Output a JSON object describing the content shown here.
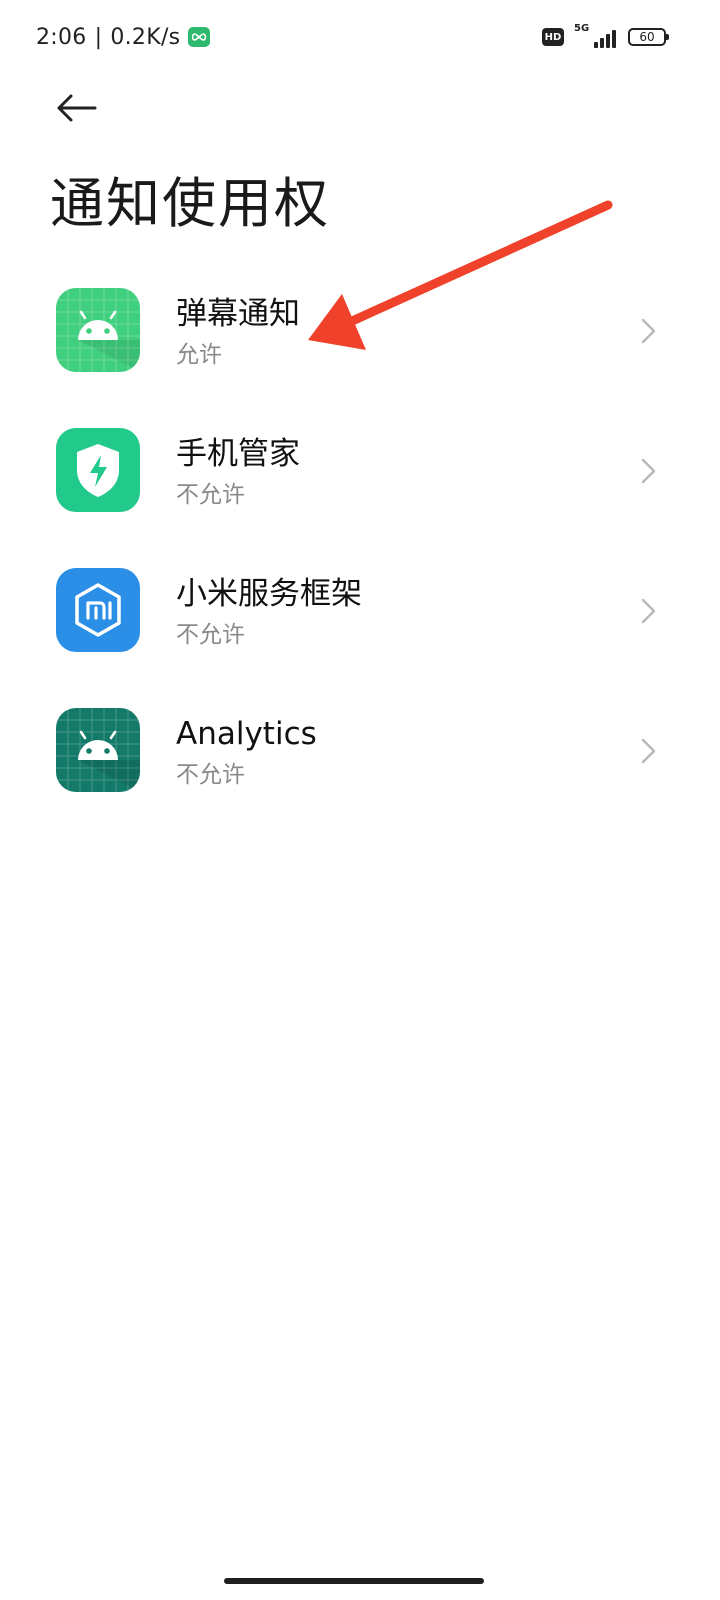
{
  "status_bar": {
    "time": "2:06",
    "separator": "|",
    "net_speed": "0.2K/s",
    "hd_label": "HD",
    "network_type": "5G",
    "battery": "60",
    "vpn_icon": "infinity-app-icon",
    "accent": "#2fb96e"
  },
  "header": {
    "back_icon": "back-arrow-icon",
    "title": "通知使用权"
  },
  "apps": [
    {
      "name": "弹幕通知",
      "status": "允许",
      "icon": "android-robot-icon",
      "color": "#3fcf7e"
    },
    {
      "name": "手机管家",
      "status": "不允许",
      "icon": "shield-lightning-icon",
      "color": "#21c98a"
    },
    {
      "name": "小米服务框架",
      "status": "不允许",
      "icon": "mi-hexagon-icon",
      "color": "#2b8fe8"
    },
    {
      "name": "Analytics",
      "status": "不允许",
      "icon": "android-robot-icon",
      "color": "#137a6a"
    }
  ],
  "annotation": {
    "icon": "red-arrow-annotation",
    "color": "#f0412a"
  }
}
